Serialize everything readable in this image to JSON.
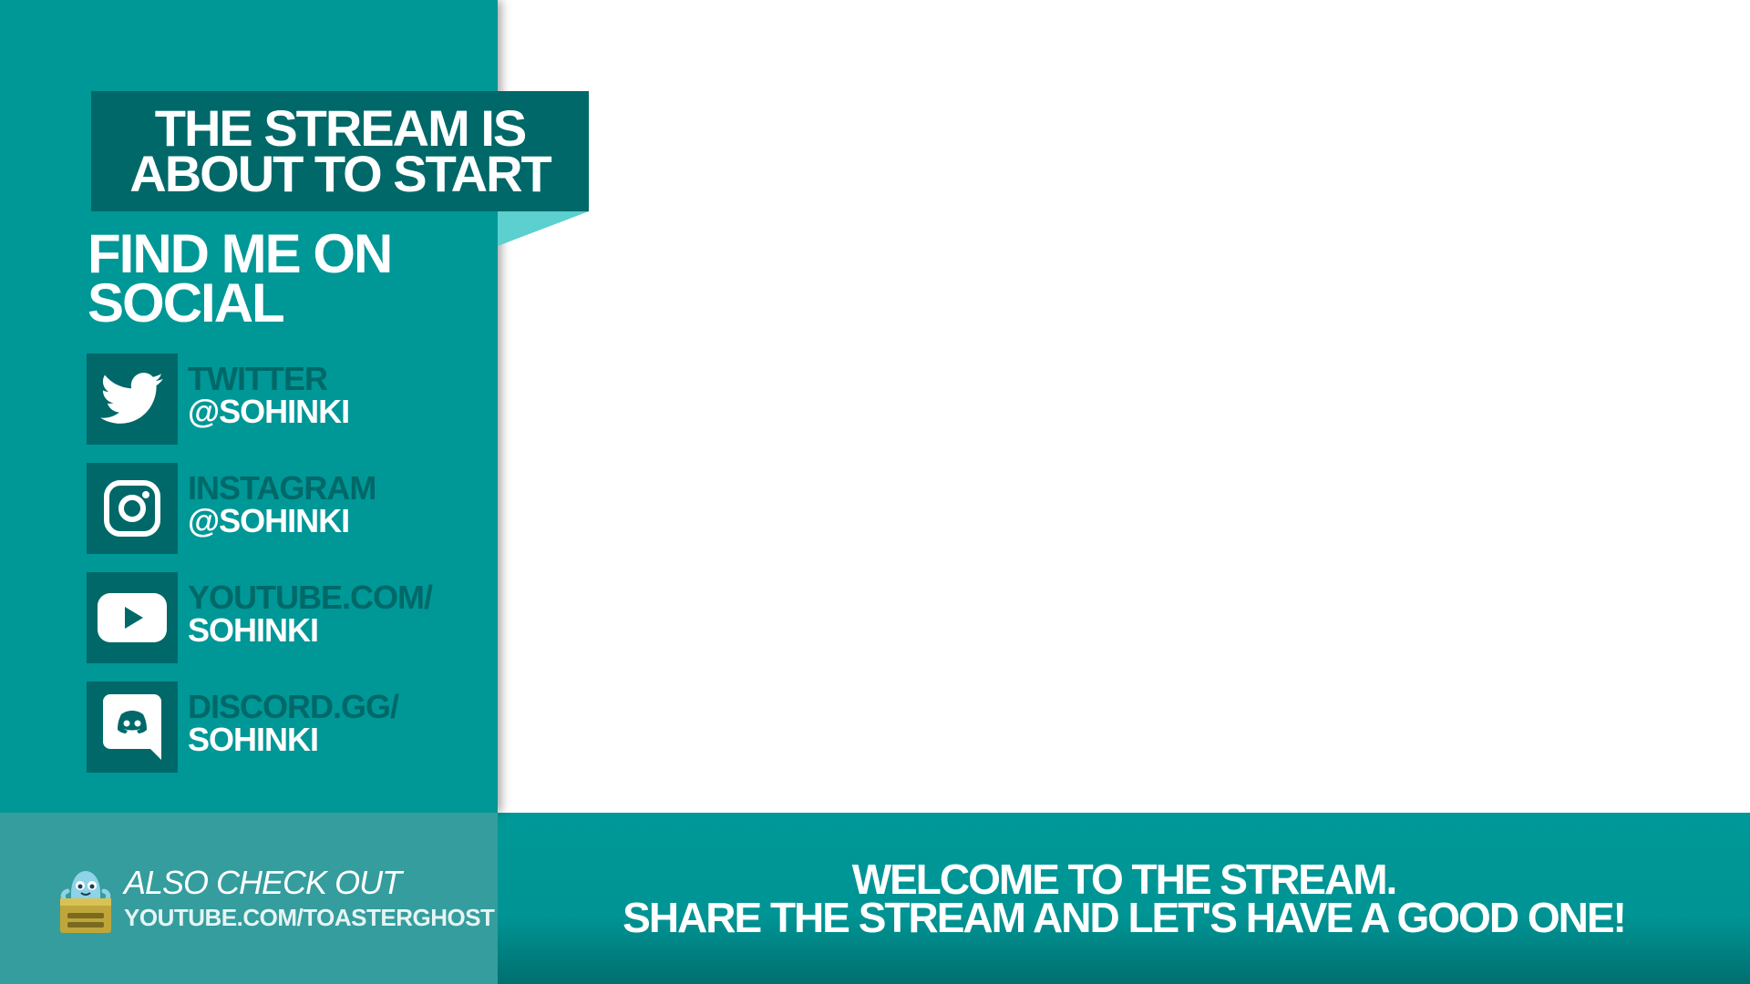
{
  "banner": {
    "line1": "THE STREAM IS",
    "line2": "ABOUT TO START"
  },
  "social": {
    "heading_line1": "FIND ME ON",
    "heading_line2": "SOCIAL",
    "items": [
      {
        "icon": "twitter-icon",
        "platform": "TWITTER",
        "handle": "@SOHINKI"
      },
      {
        "icon": "instagram-icon",
        "platform": "INSTAGRAM",
        "handle": "@SOHINKI"
      },
      {
        "icon": "youtube-icon",
        "platform": "YOUTUBE.COM/",
        "handle": "SOHINKI"
      },
      {
        "icon": "discord-icon",
        "platform": "DISCORD.GG/",
        "handle": "SOHINKI"
      }
    ]
  },
  "promo": {
    "line1": "ALSO CHECK OUT",
    "line2": "YOUTUBE.COM/TOASTERGHOST"
  },
  "footer": {
    "line1": "WELCOME TO THE STREAM.",
    "line2": "SHARE THE STREAM AND LET'S HAVE A GOOD ONE!"
  },
  "colors": {
    "sidebar": "#009797",
    "banner": "#006868",
    "accent": "#5ccfcf",
    "promo": "#359d9d"
  }
}
